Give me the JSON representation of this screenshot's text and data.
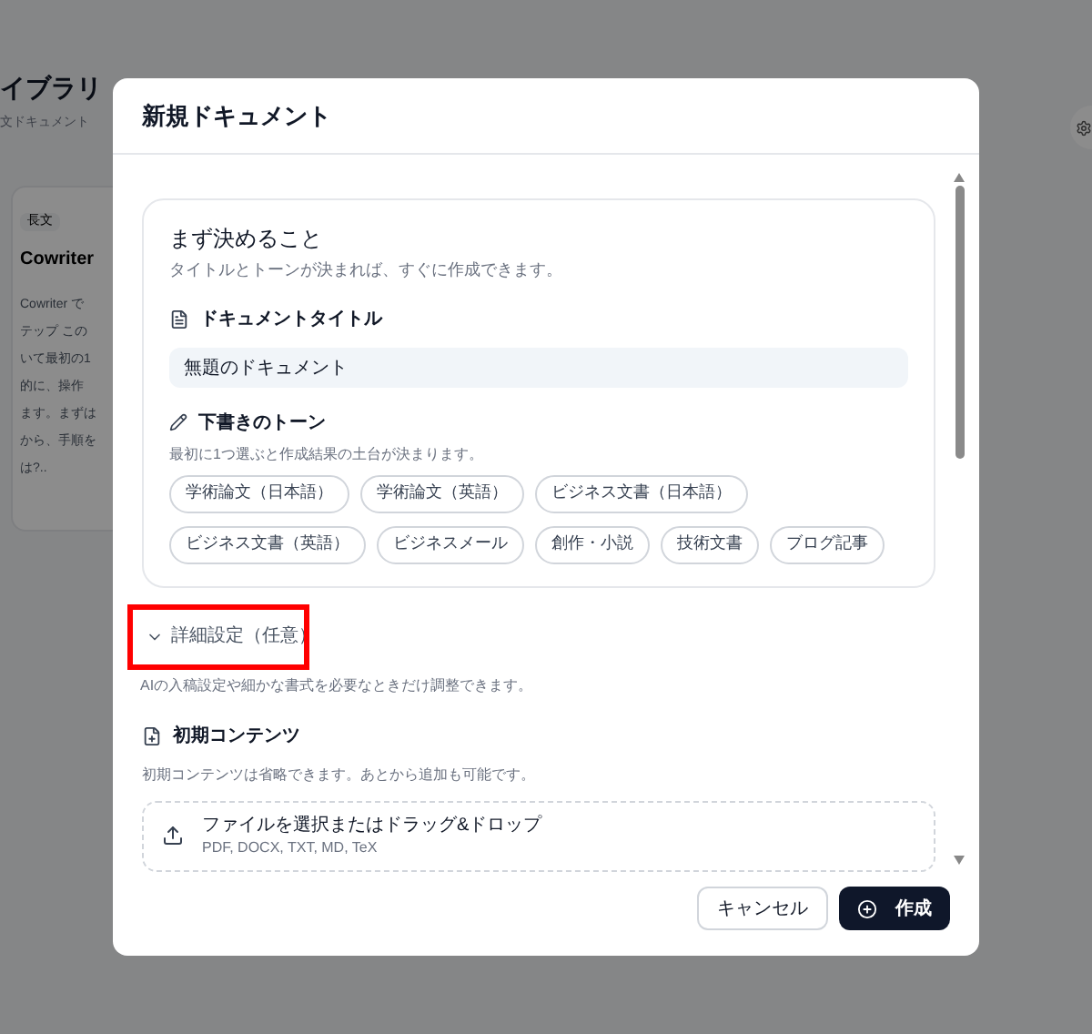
{
  "background": {
    "title": "イブラリ",
    "subtitle": "文ドキュメント",
    "card": {
      "badge": "長文",
      "title": "Cowriter",
      "lines": [
        "Cowriter で",
        "テップ この",
        "いて最初の1",
        "的に、操作",
        "ます。まずは",
        "から、手順を",
        "は?.."
      ]
    }
  },
  "dialog": {
    "title": "新規ドキュメント",
    "essentials": {
      "heading": "まず決めること",
      "description": "タイトルとトーンが決まれば、すぐに作成できます。",
      "title_field": {
        "label": "ドキュメントタイトル",
        "value": "無題のドキュメント"
      },
      "tone": {
        "label": "下書きのトーン",
        "hint": "最初に1つ選ぶと作成結果の土台が決まります。",
        "options": [
          {
            "label": "学術論文（日本語）",
            "selected": false
          },
          {
            "label": "学術論文（英語）",
            "selected": false
          },
          {
            "label": "ビジネス文書（日本語）",
            "selected": false
          },
          {
            "label": "ビジネス文書（英語）",
            "selected": false
          },
          {
            "label": "ビジネスメール",
            "selected": false
          },
          {
            "label": "創作・小説",
            "selected": false
          },
          {
            "label": "技術文書",
            "selected": false
          },
          {
            "label": "ブログ記事",
            "selected": false
          }
        ]
      }
    },
    "advanced": {
      "label": "詳細設定（任意）",
      "expanded": false,
      "highlighted": true,
      "description": "AIの入稿設定や細かな書式を必要なときだけ調整できます。"
    },
    "initial_content": {
      "label": "初期コンテンツ",
      "hint": "初期コンテンツは省略できます。あとから追加も可能です。",
      "upload": {
        "label": "ファイルを選択またはドラッグ&ドロップ",
        "formats": "PDF, DOCX, TXT, MD, TeX"
      }
    },
    "buttons": [
      {
        "kind": "secondary",
        "label": "キャンセル"
      },
      {
        "kind": "primary",
        "label": "作成"
      }
    ]
  }
}
